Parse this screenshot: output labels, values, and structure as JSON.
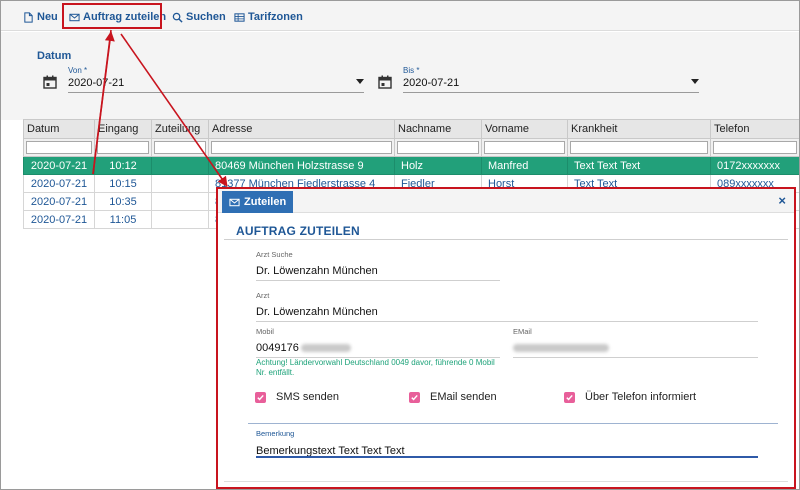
{
  "toolbar": {
    "items": [
      {
        "label": "Neu",
        "icon": "file-icon"
      },
      {
        "label": "Auftrag zuteilen",
        "icon": "envelope-icon"
      },
      {
        "label": "Suchen",
        "icon": "search-icon"
      },
      {
        "label": "Tarifzonen",
        "icon": "table-icon"
      }
    ]
  },
  "filter": {
    "section_label": "Datum",
    "von": {
      "label": "Von *",
      "value": "2020-07-21"
    },
    "bis": {
      "label": "Bis *",
      "value": "2020-07-21"
    }
  },
  "grid": {
    "columns": [
      "Datum",
      "Eingang",
      "Zuteilung",
      "Adresse",
      "Nachname",
      "Vorname",
      "Krankheit",
      "Telefon"
    ],
    "rows": [
      [
        "2020-07-21",
        "10:12",
        "",
        "80469 München Holzstrasse 9",
        "Holz",
        "Manfred",
        "Text Text Text",
        "0172xxxxxxx"
      ],
      [
        "2020-07-21",
        "10:15",
        "",
        "81377 München Fiedlerstrasse 4",
        "Fiedler",
        "Horst",
        "Text Text",
        "089xxxxxxx"
      ],
      [
        "2020-07-21",
        "10:35",
        "",
        "8",
        "",
        "",
        "",
        ""
      ],
      [
        "2020-07-21",
        "11:05",
        "",
        "8",
        "",
        "",
        "",
        ""
      ]
    ],
    "selected_row": 0
  },
  "dialog": {
    "tab_label": "Zuteilen",
    "close_label": "×",
    "title": "AUFTRAG ZUTEILEN",
    "arzt_suche": {
      "label": "Arzt Suche",
      "value": "Dr. Löwenzahn München"
    },
    "arzt": {
      "label": "Arzt",
      "value": "Dr. Löwenzahn München"
    },
    "mobil": {
      "label": "Mobil",
      "value": "0049176"
    },
    "email": {
      "label": "EMail"
    },
    "mobil_warning": "Achtung! Ländervorwahl Deutschland 0049 davor, führende 0 Mobil Nr. entfällt.",
    "checkboxes": [
      {
        "label": "SMS senden",
        "checked": true
      },
      {
        "label": "EMail senden",
        "checked": true
      },
      {
        "label": "Über Telefon informiert",
        "checked": true
      }
    ],
    "bemerkung": {
      "label": "Bemerkung",
      "value": "Bemerkungstext Text Text Text"
    }
  },
  "colors": {
    "accent": "#1f5796",
    "selected_row": "#22a07a",
    "highlight": "#c8141e",
    "checkbox": "#e85f9a",
    "tab": "#2f6fb4"
  }
}
